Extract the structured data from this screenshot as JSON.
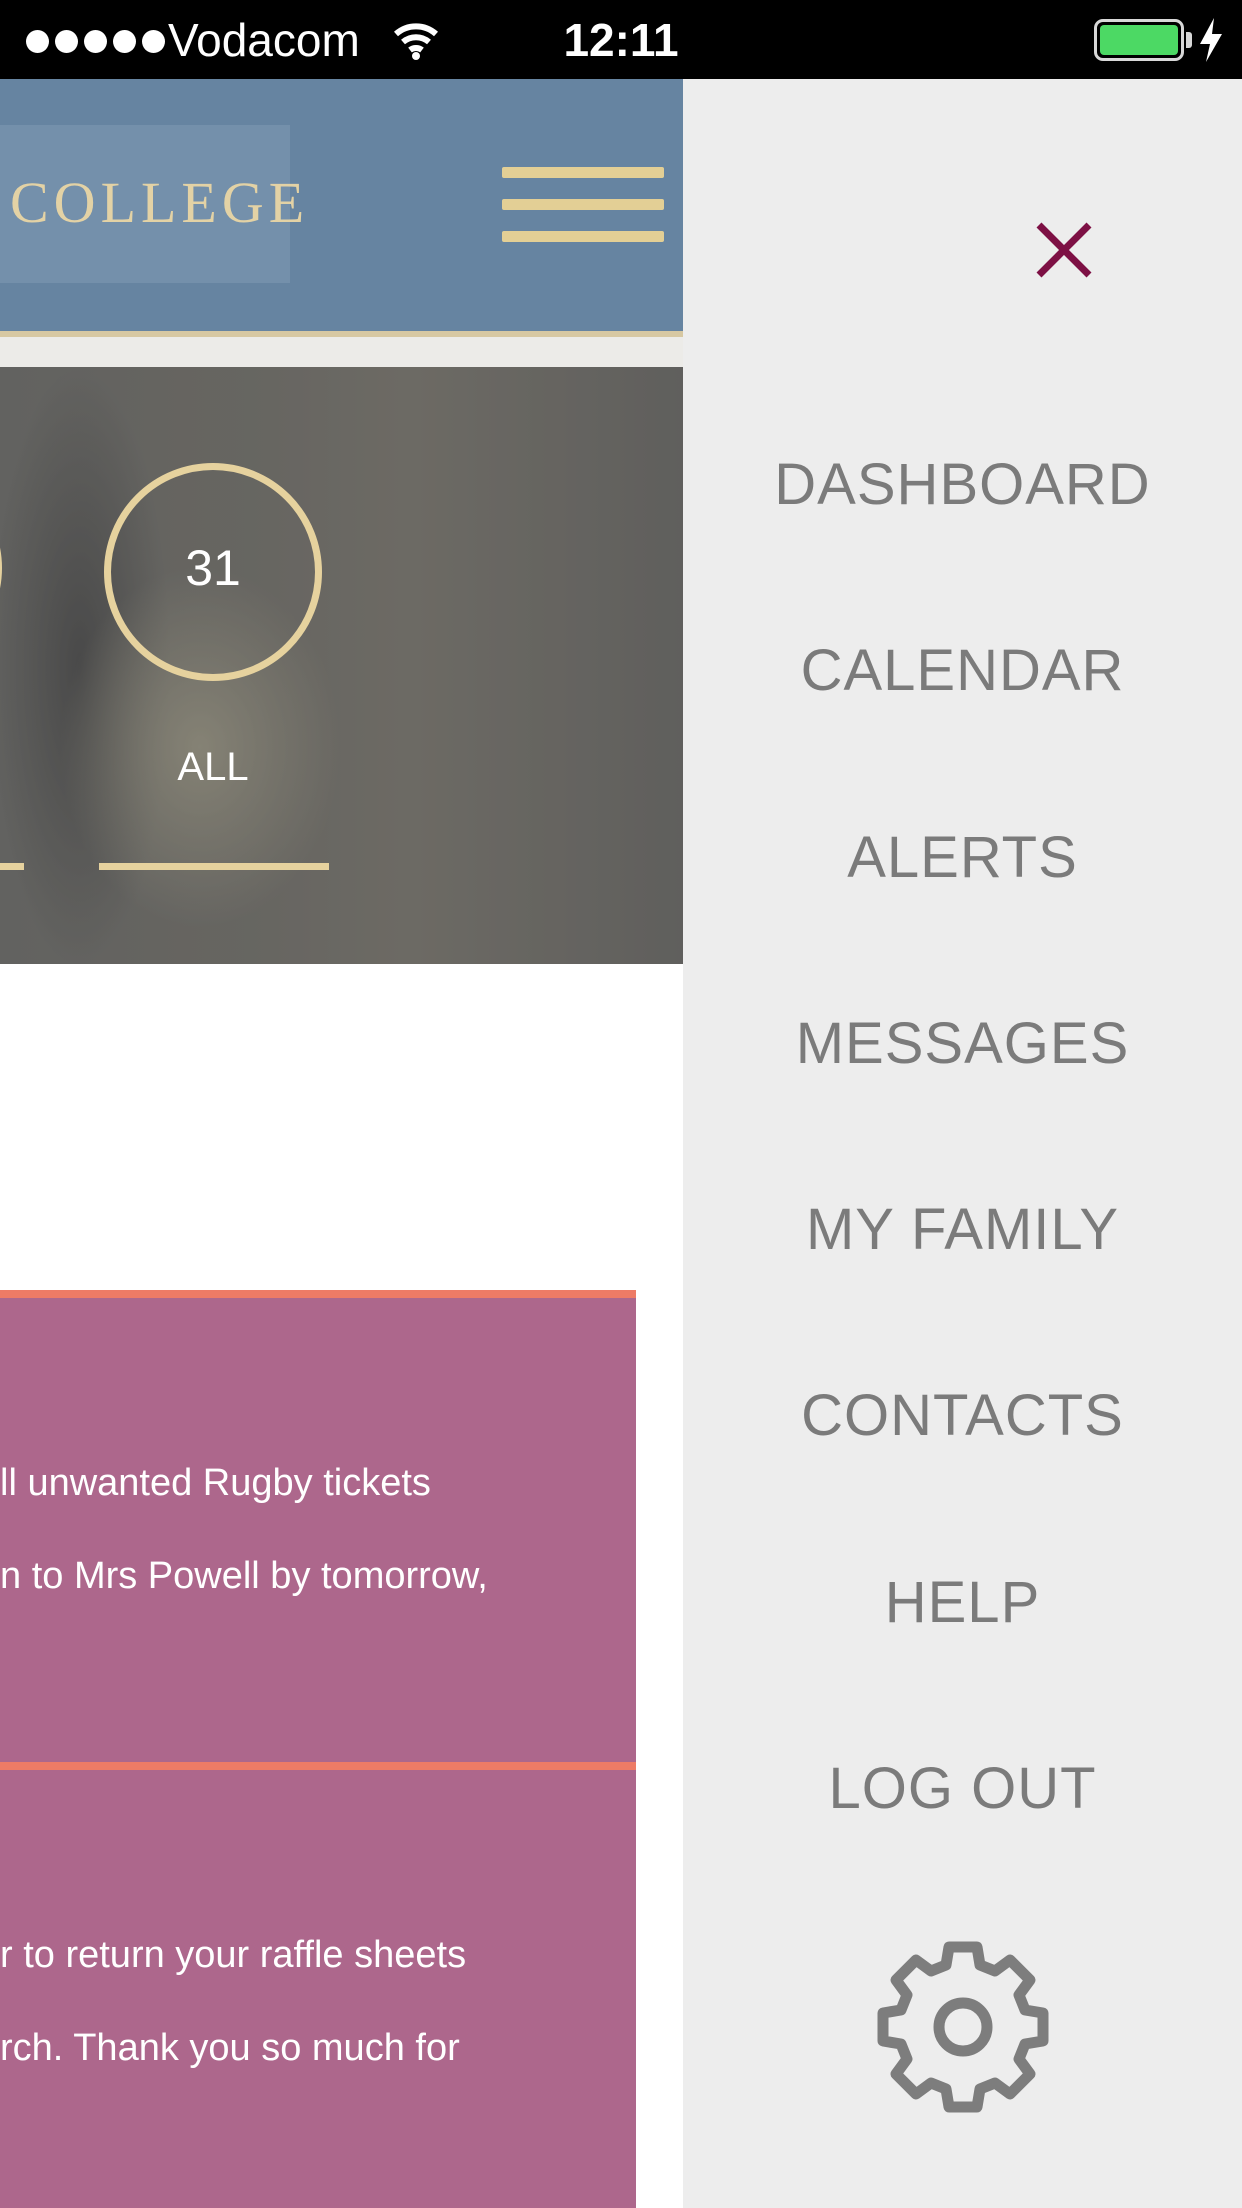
{
  "status_bar": {
    "carrier": "Vodacom",
    "time": "12:11",
    "battery_level": 1.0,
    "icons": [
      "signal-dots-icon",
      "wifi-icon",
      "battery-icon",
      "charging-bolt-icon"
    ]
  },
  "header": {
    "logo_text": "COLLEGE",
    "menu_icon": "hamburger-icon"
  },
  "hero": {
    "count": "31",
    "filter_label": "ALL"
  },
  "cards": [
    {
      "lines": [
        "ll unwanted Rugby tickets",
        "n to Mrs Powell by tomorrow,"
      ]
    },
    {
      "lines": [
        "r to return your raffle sheets",
        "rch. Thank you so much for"
      ]
    }
  ],
  "drawer": {
    "close_icon": "close-icon",
    "items": [
      "DASHBOARD",
      "CALENDAR",
      "ALERTS",
      "MESSAGES",
      "MY FAMILY",
      "CONTACTS",
      "HELP",
      "LOG OUT"
    ],
    "settings_icon": "gear-icon"
  },
  "colors": {
    "header": "#6684a1",
    "accent_gold": "#e6d29e",
    "card": "#ad678c",
    "card_border": "#ee7b66",
    "close": "#7d1044",
    "menu_text": "#7b7b7b",
    "drawer_bg": "#ededed"
  }
}
